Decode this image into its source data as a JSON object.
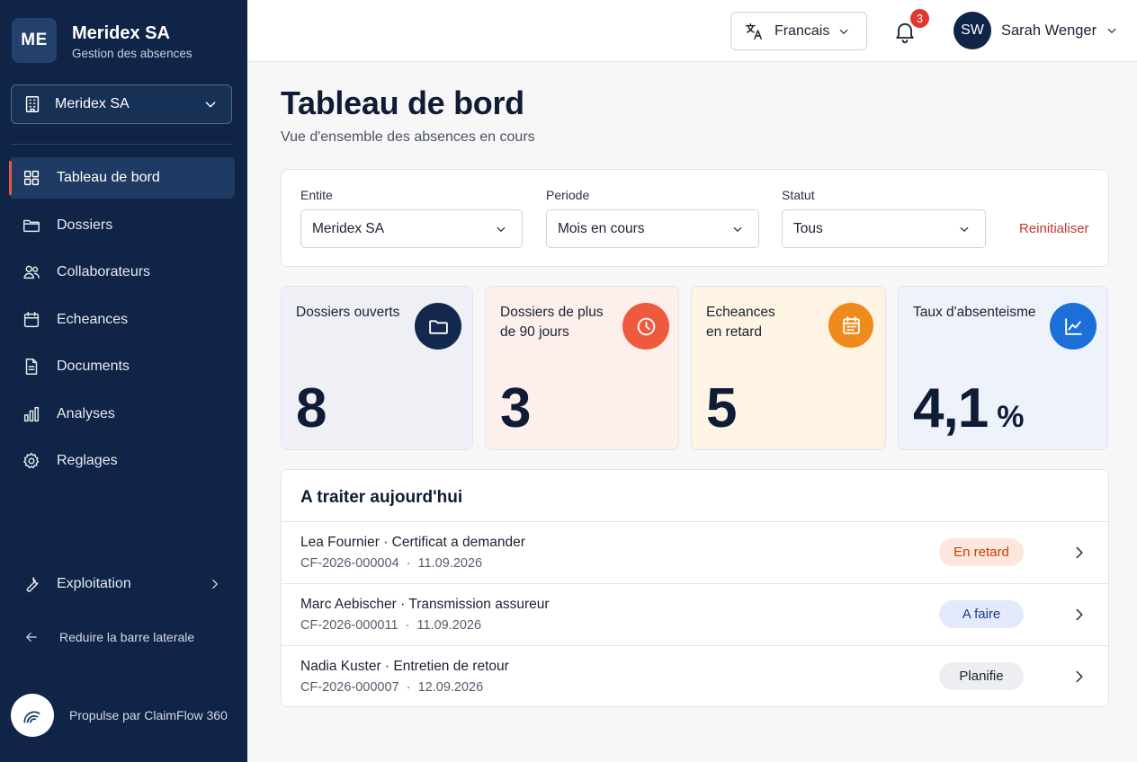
{
  "brand": {
    "initials": "ME",
    "name": "Meridex SA",
    "subtitle": "Gestion des absences"
  },
  "entity_switcher": {
    "value": "Meridex SA"
  },
  "nav": [
    {
      "label": "Tableau de bord",
      "icon": "grid-icon",
      "active": true
    },
    {
      "label": "Dossiers",
      "icon": "folder-icon"
    },
    {
      "label": "Collaborateurs",
      "icon": "users-icon"
    },
    {
      "label": "Echeances",
      "icon": "calendar-icon"
    },
    {
      "label": "Documents",
      "icon": "document-icon"
    },
    {
      "label": "Analyses",
      "icon": "bar-chart-icon"
    },
    {
      "label": "Reglages",
      "icon": "gear-icon"
    }
  ],
  "exploitation": {
    "label": "Exploitation",
    "icon": "wrench-icon"
  },
  "collapse": {
    "label": "Reduire la barre laterale",
    "icon": "arrow-left-icon"
  },
  "powered_by": {
    "label": "Propulse par ClaimFlow 360",
    "icon": "claimflow-logo"
  },
  "topbar": {
    "language": {
      "value": "Francais",
      "icon": "translate-icon"
    },
    "notifications": {
      "count": "3",
      "icon": "bell-icon"
    },
    "user": {
      "initials": "SW",
      "name": "Sarah Wenger"
    }
  },
  "page": {
    "title": "Tableau de bord",
    "subtitle": "Vue d'ensemble des absences en cours"
  },
  "filters": {
    "entity": {
      "label": "Entite",
      "value": "Meridex SA"
    },
    "period": {
      "label": "Periode",
      "value": "Mois en cours"
    },
    "status": {
      "label": "Statut",
      "value": "Tous"
    },
    "reset_label": "Reinitialiser"
  },
  "kpis": [
    {
      "title": "Dossiers ouverts",
      "value": "8",
      "unit": "",
      "icon": "folder-icon",
      "icon_color": "#13284c",
      "bg": "#eef0f6"
    },
    {
      "title": "Dossiers de plus\nde 90 jours",
      "value": "3",
      "unit": "",
      "icon": "clock-icon",
      "icon_color": "#ee5a3e",
      "bg": "#fdefec"
    },
    {
      "title": "Echeances\nen retard",
      "value": "5",
      "unit": "",
      "icon": "calendar-icon",
      "icon_color": "#f08a1c",
      "bg": "#fdf4e3"
    },
    {
      "title": "Taux d'absenteisme",
      "value": "4,1",
      "unit": "%",
      "icon": "trend-icon",
      "icon_color": "#1a6fd8",
      "bg": "#eef2fb"
    }
  ],
  "todo": {
    "title": "A traiter aujourd'hui",
    "rows": [
      {
        "person": "Lea Fournier",
        "task": "Certificat a demander",
        "ref": "CF-2026-000004",
        "date": "11.09.2026",
        "status": "En retard",
        "status_bg": "#fde6dc",
        "status_fg": "#c2410c"
      },
      {
        "person": "Marc Aebischer",
        "task": "Transmission assureur",
        "ref": "CF-2026-000011",
        "date": "11.09.2026",
        "status": "A faire",
        "status_bg": "#e4eafb",
        "status_fg": "#1e3a8a"
      },
      {
        "person": "Nadia Kuster",
        "task": "Entretien de retour",
        "ref": "CF-2026-000007",
        "date": "12.09.2026",
        "status": "Planifie",
        "status_bg": "#eceef1",
        "status_fg": "#1b2233"
      }
    ]
  }
}
